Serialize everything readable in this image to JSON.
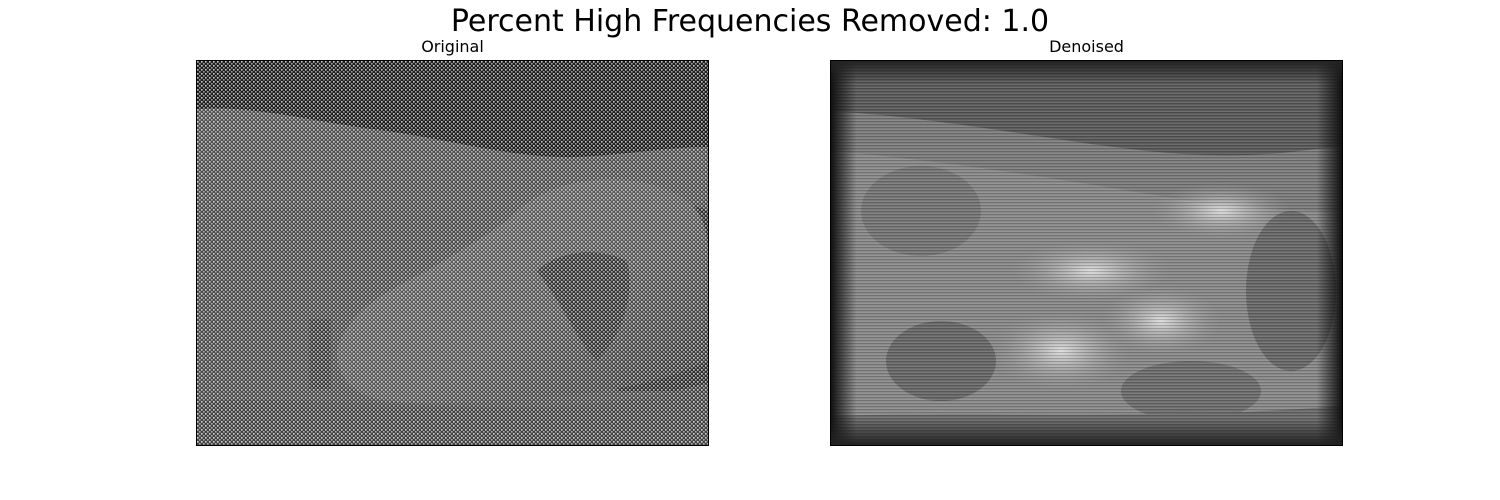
{
  "figure": {
    "suptitle": "Percent High Frequencies Removed: 1.0"
  },
  "panels": [
    {
      "title": "Original",
      "image": "lunar surface boulder photograph with periodic noise pattern"
    },
    {
      "title": "Denoised",
      "image": "blurred lunar surface boulder photograph with horizontal streaks"
    }
  ]
}
